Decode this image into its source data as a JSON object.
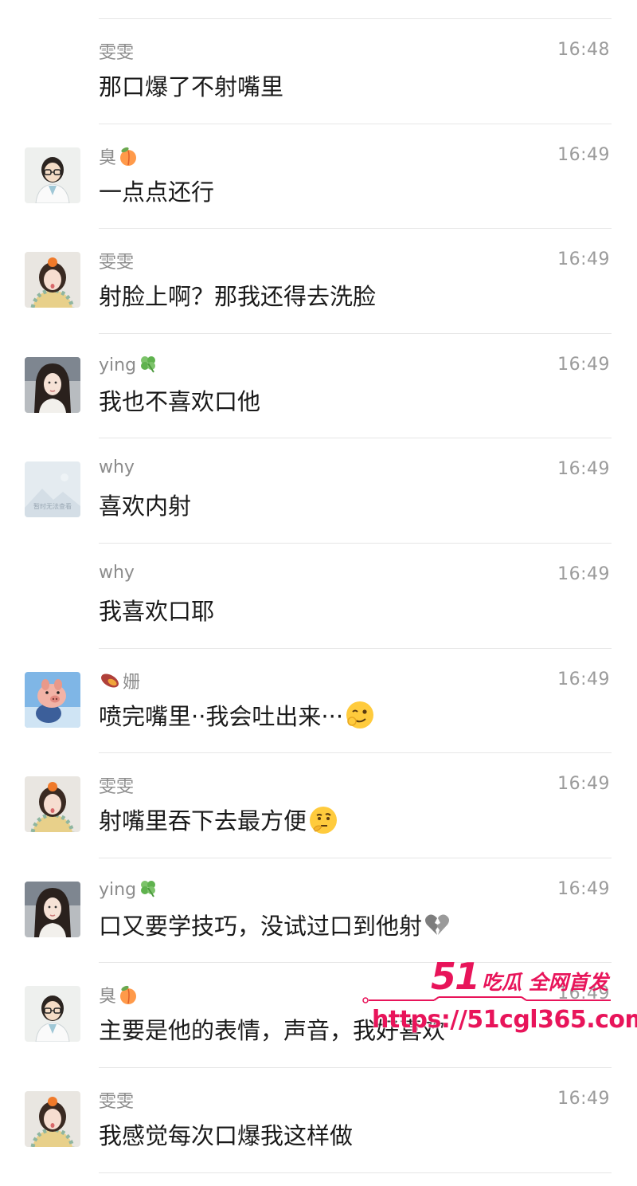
{
  "messages": [
    {
      "sender": "雯雯",
      "time": "16:48",
      "text": "那口爆了不射嘴里",
      "avatar": "none"
    },
    {
      "sender": "臭",
      "sender_emoji": "peach-emoji",
      "time": "16:49",
      "text": "一点点还行",
      "avatar": "glasses-doctor-avatar"
    },
    {
      "sender": "雯雯",
      "time": "16:49",
      "text": "射脸上啊？那我还得去洗脸",
      "avatar": "girl-avatar"
    },
    {
      "sender": "ying",
      "sender_emoji": "clover-emoji",
      "time": "16:49",
      "text": "我也不喜欢口他",
      "avatar": "long-hair-girl-avatar"
    },
    {
      "sender": "why",
      "time": "16:49",
      "text": "喜欢内射",
      "avatar": "placeholder-landscape-avatar"
    },
    {
      "sender": "why",
      "time": "16:49",
      "text": "我喜欢口耶",
      "avatar": "none"
    },
    {
      "sender": "姗",
      "sender_emoji": "sweet-potato-emoji",
      "time": "16:49",
      "text": "喷完嘴里··我会吐出来···",
      "text_emoji": "wink-emoji",
      "avatar": "pig-toy-avatar"
    },
    {
      "sender": "雯雯",
      "time": "16:49",
      "text": "射嘴里吞下去最方便",
      "text_emoji": "thinking-emoji",
      "avatar": "girl-avatar"
    },
    {
      "sender": "ying",
      "sender_emoji": "clover-emoji",
      "time": "16:49",
      "text": "口又要学技巧，没试过口到他射",
      "text_emoji": "broken-heart-emoji",
      "avatar": "long-hair-girl-avatar"
    },
    {
      "sender": "臭",
      "sender_emoji": "peach-emoji",
      "time": "16:49",
      "text": "主要是他的表情，声音，我好喜欢",
      "avatar": "glasses-doctor-avatar"
    },
    {
      "sender": "雯雯",
      "time": "16:49",
      "text": "我感觉每次口爆我这样做",
      "avatar": "girl-avatar"
    }
  ],
  "placeholder_avatar_caption": "暂时无法查看",
  "watermark": {
    "logo_number": "51",
    "logo_tagline": "吃瓜 全网首发",
    "url": "https://51cgl365.com"
  },
  "colors": {
    "text": "#1a1a1a",
    "meta": "#8c8c8c",
    "divider": "#e6e6e6",
    "watermark": "#e8145a"
  }
}
